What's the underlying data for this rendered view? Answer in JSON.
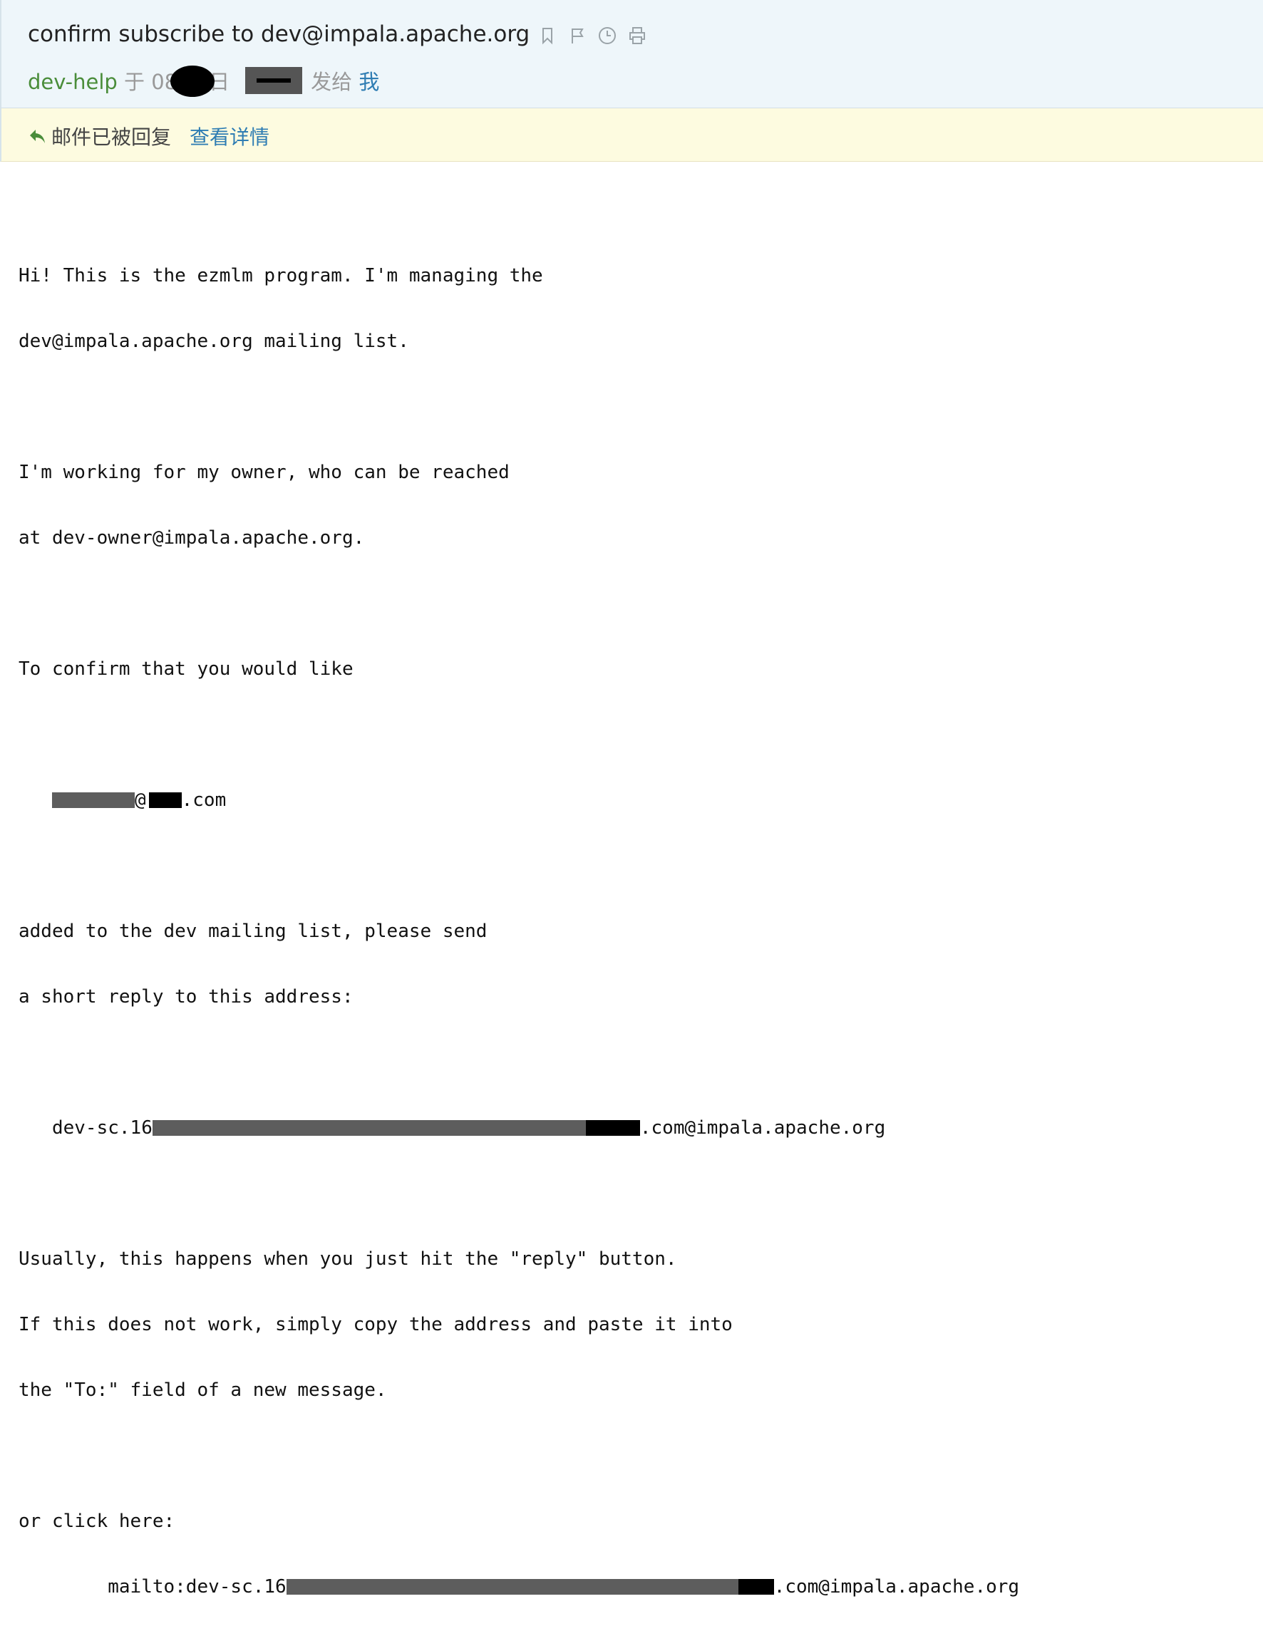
{
  "header": {
    "subject": "confirm subscribe to dev@impala.apache.org",
    "sender": "dev-help",
    "date_prefix": "于 08",
    "date_suffix": "日",
    "sent_to_label": "发给",
    "recipient": "我",
    "toolbar_icons": [
      "bookmark-icon",
      "flag-icon",
      "clock-icon",
      "print-icon"
    ]
  },
  "notice": {
    "text": "邮件已被回复",
    "link": "查看详情"
  },
  "body": {
    "l1": "Hi! This is the ezmlm program. I'm managing the",
    "l2": "dev@impala.apache.org mailing list.",
    "l3": "I'm working for my owner, who can be reached",
    "l4": "at dev-owner@impala.apache.org.",
    "l5": "To confirm that you would like",
    "email_at": "@",
    "email_domain": ".com",
    "l6": "added to the dev mailing list, please send",
    "l7": "a short reply to this address:",
    "addr_prefix": "dev-sc.16",
    "addr_suffix": ".com@impala.apache.org",
    "l8": "Usually, this happens when you just hit the \"reply\" button.",
    "l9": "If this does not work, simply copy the address and paste it into",
    "l10": "the \"To:\" field of a new message.",
    "l11": "or click here:",
    "mailto_prefix": "mailto:dev-sc.16",
    "mailto_suffix": ".com@impala.apache.org"
  }
}
